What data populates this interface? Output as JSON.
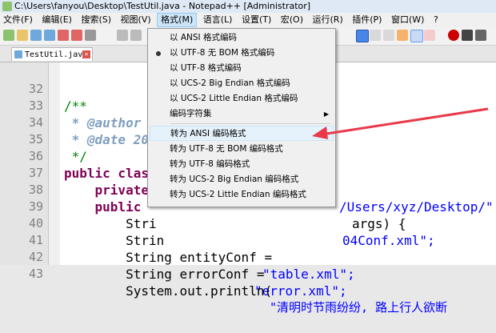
{
  "window": {
    "title": "C:\\Users\\fanyou\\Desktop\\TestUtil.java - Notepad++ [Administrator]"
  },
  "menubar": {
    "items": [
      "文件(F)",
      "编辑(E)",
      "搜索(S)",
      "视图(V)",
      "格式(M)",
      "语言(L)",
      "设置(T)",
      "宏(O)",
      "运行(R)",
      "插件(P)",
      "窗口(W)",
      "?"
    ],
    "active": "格式(M)"
  },
  "tab": {
    "label": "TestUtil.java",
    "close_icon": "close-icon"
  },
  "format_menu": {
    "items": [
      {
        "label": "以 ANSI 格式编码"
      },
      {
        "label": "以 UTF-8 无 BOM 格式编码",
        "selected": true
      },
      {
        "label": "以 UTF-8 格式编码"
      },
      {
        "label": "以 UCS-2 Big Endian 格式编码"
      },
      {
        "label": "以 UCS-2 Little Endian 格式编码"
      },
      {
        "label": "编码字符集",
        "submenu": true
      },
      {
        "label": "转为 ANSI 编码格式",
        "highlighted": true
      },
      {
        "label": "转为 UTF-8 无 BOM 编码格式"
      },
      {
        "label": "转为 UTF-8 编码格式"
      },
      {
        "label": "转为 UCS-2 Big Endian 编码格式"
      },
      {
        "label": "转为 UCS-2 Little Endian 编码格式"
      }
    ]
  },
  "editor": {
    "lines": [
      {
        "num": "32",
        "text": "/**"
      },
      {
        "num": "33",
        "text": " * @author"
      },
      {
        "num": "34",
        "text": " * @date 20"
      },
      {
        "num": "35",
        "text": " */"
      },
      {
        "num": "36",
        "text": "public clas"
      },
      {
        "num": "37",
        "text": "    private"
      },
      {
        "num": "38",
        "text": "    public"
      },
      {
        "num": "39",
        "text": "        Stri"
      },
      {
        "num": "40",
        "text": "        Strin"
      },
      {
        "num": "41",
        "text": "        String entityConf = "
      },
      {
        "num": "42",
        "text": "        String errorConf = "
      },
      {
        "num": "43",
        "text": "        System.out.println("
      }
    ],
    "right_fragments": {
      "line37": "/Users/xyz/Desktop/\"",
      "line38": "args) {",
      "line39": "04Conf.xml\";",
      "line41": "\"table.xml\";",
      "line42": "\"error.xml\";",
      "line43": "\"清明时节雨纷纷, 路上行人欲断"
    }
  },
  "annotation": {
    "arrow_color": "#e8394a"
  }
}
